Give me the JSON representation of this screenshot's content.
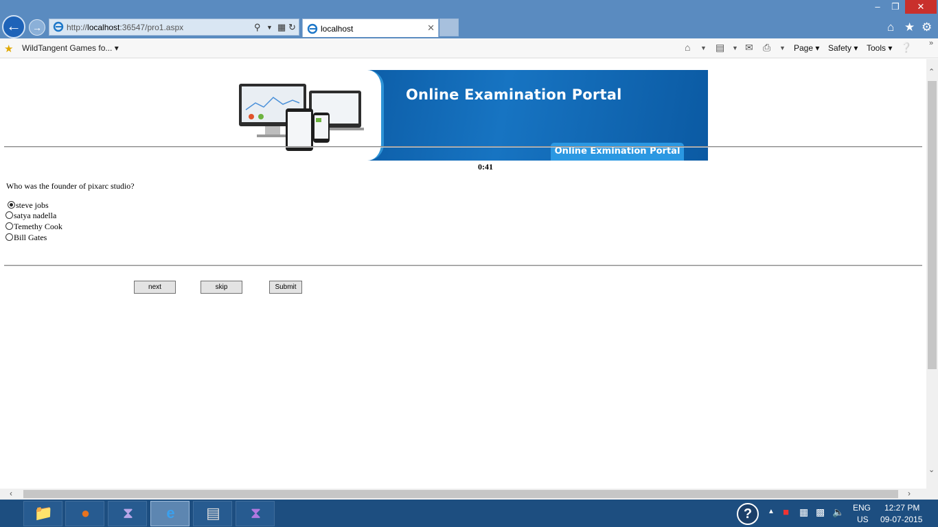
{
  "browser": {
    "url_prefix": "http://",
    "url_host": "localhost",
    "url_rest": ":36547/pro1.aspx",
    "tab_label": "localhost",
    "favorite": "WildTangent Games fo...",
    "commands": {
      "page": "Page",
      "safety": "Safety",
      "tools": "Tools"
    }
  },
  "banner": {
    "title": "Online Examination Portal",
    "pill": "Online Exmination Portal"
  },
  "exam": {
    "timer": "0:41",
    "question": "Who was the founder of pixarc studio?",
    "options": [
      {
        "label": "steve jobs",
        "checked": true
      },
      {
        "label": "satya nadella",
        "checked": false
      },
      {
        "label": "Temethy Cook",
        "checked": false
      },
      {
        "label": "Bill Gates",
        "checked": false
      }
    ],
    "buttons": {
      "next": "next",
      "skip": "skip",
      "submit": "Submit"
    }
  },
  "taskbar": {
    "language": "ENG",
    "region": "US",
    "time": "12:27 PM",
    "date": "09-07-2015"
  },
  "colors": {
    "titlebar": "#5a8bc0",
    "taskbar": "#1d4e80",
    "banner_blue": "#1774c2"
  }
}
